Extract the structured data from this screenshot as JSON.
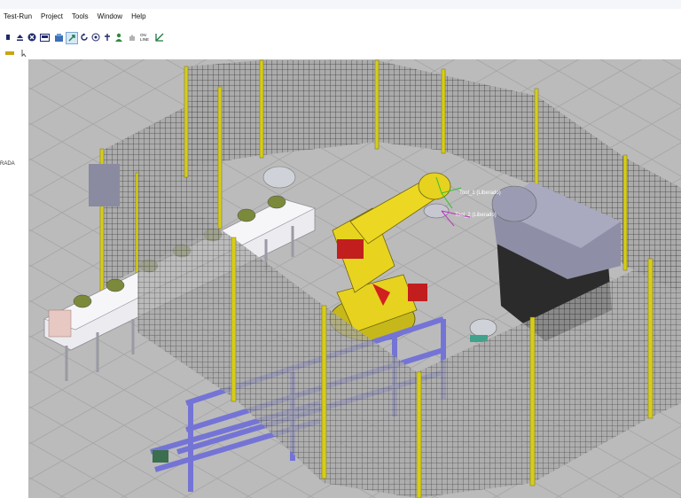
{
  "menu": {
    "items": [
      "Test-Run",
      "Project",
      "Tools",
      "Window",
      "Help"
    ]
  },
  "toolbar": {
    "online_label": "ON LINE"
  },
  "side_panel": {
    "fragment_text": "RADA"
  },
  "viewport": {
    "tool_frame_label": "Tool_1 (Liberado)",
    "user_frame_label": "Tool_2 (Liberado)"
  },
  "colors": {
    "floor": "#b9b9b9",
    "robot": "#e6d21f",
    "fence_post": "#d6cd1a",
    "fence_mesh": "#333333",
    "rack": "#7474d6",
    "machine": "#2a2a2a",
    "housing": "#8f8fa8",
    "conveyor": "#e8e8ec"
  }
}
